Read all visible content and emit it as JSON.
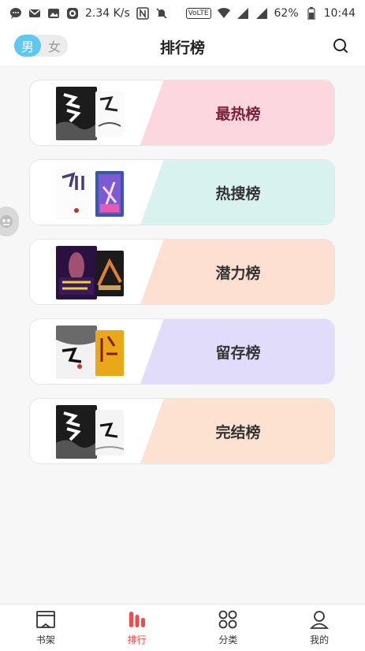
{
  "status_bar": {
    "speed": "2.34 K/s",
    "battery": "62%",
    "time": "10:44",
    "volte": "VoLTE"
  },
  "header": {
    "title": "排行榜",
    "gender": {
      "male": "男",
      "female": "女",
      "selected": "male"
    }
  },
  "rankings": [
    {
      "label": "最热榜",
      "band_color": "#fdd7e0",
      "text_color": "#7a1f3a"
    },
    {
      "label": "热搜榜",
      "band_color": "#d8f3ef",
      "text_color": "#333333"
    },
    {
      "label": "潜力榜",
      "band_color": "#fde0d2",
      "text_color": "#333333"
    },
    {
      "label": "留存榜",
      "band_color": "#e2dcfb",
      "text_color": "#333333"
    },
    {
      "label": "完结榜",
      "band_color": "#fde2d2",
      "text_color": "#333333"
    }
  ],
  "bottom_nav": [
    {
      "label": "书架",
      "icon": "bookshelf-icon",
      "active": false
    },
    {
      "label": "排行",
      "icon": "ranking-icon",
      "active": true
    },
    {
      "label": "分类",
      "icon": "category-icon",
      "active": false
    },
    {
      "label": "我的",
      "icon": "profile-icon",
      "active": false
    }
  ],
  "colors": {
    "accent": "#5ec8f0",
    "nav_active": "#ee4b4b"
  }
}
